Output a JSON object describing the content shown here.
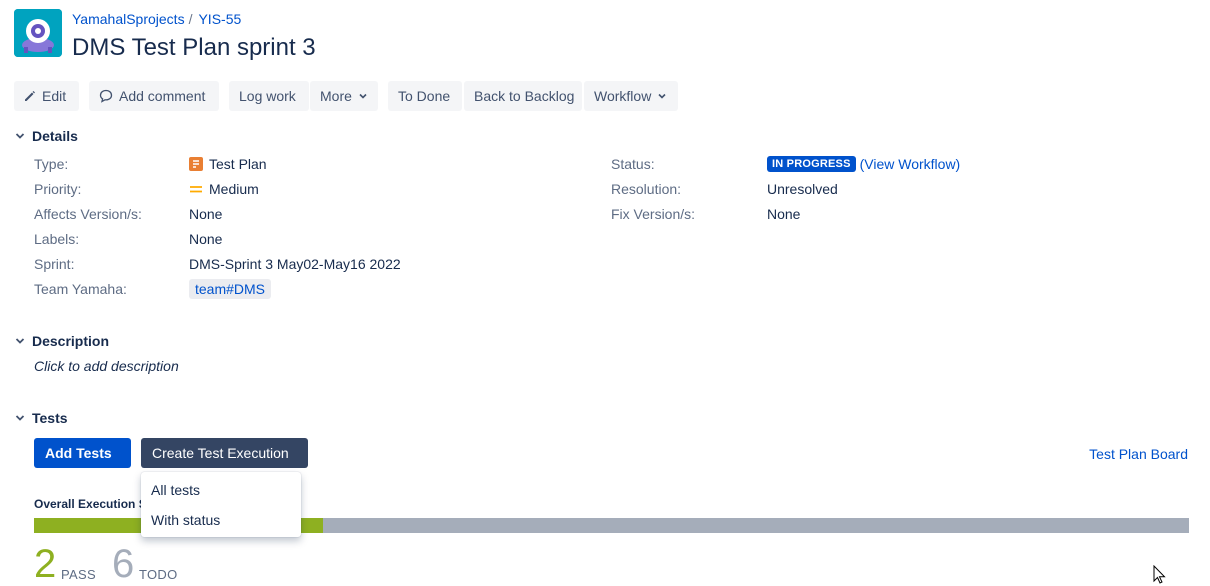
{
  "breadcrumb": {
    "project": "YamahalSprojects",
    "issue_key": "YIS-55"
  },
  "issue": {
    "title": "DMS Test Plan sprint 3"
  },
  "toolbar": {
    "edit": "Edit",
    "add_comment": "Add comment",
    "log_work": "Log work",
    "more": "More",
    "to_done": "To Done",
    "back_to_backlog": "Back to Backlog",
    "workflow": "Workflow"
  },
  "details": {
    "heading": "Details",
    "type_label": "Type:",
    "type_value": "Test Plan",
    "priority_label": "Priority:",
    "priority_value": "Medium",
    "affects_label": "Affects Version/s:",
    "affects_value": "None",
    "labels_label": "Labels:",
    "labels_value": "None",
    "sprint_label": "Sprint:",
    "sprint_value": "DMS-Sprint 3 May02-May16 2022",
    "team_label": "Team Yamaha:",
    "team_value": "team#DMS",
    "status_label": "Status:",
    "status_value": "IN PROGRESS",
    "view_workflow": "(View Workflow)",
    "resolution_label": "Resolution:",
    "resolution_value": "Unresolved",
    "fix_label": "Fix Version/s:",
    "fix_value": "None"
  },
  "description": {
    "heading": "Description",
    "placeholder": "Click to add description"
  },
  "tests": {
    "heading": "Tests",
    "add_tests": "Add Tests",
    "create_execution": "Create Test Execution",
    "dropdown": [
      "All tests",
      "With status"
    ],
    "board_link": "Test Plan Board",
    "overall_label": "Overall Execution St",
    "pass_fraction": 0.25,
    "pass_count": "2",
    "pass_label": "PASS",
    "todo_count": "6",
    "todo_label": "TODO"
  },
  "colors": {
    "primary": "#0052cc",
    "pass": "#8eb021",
    "todo": "#a5adba",
    "dark_button": "#344563"
  }
}
